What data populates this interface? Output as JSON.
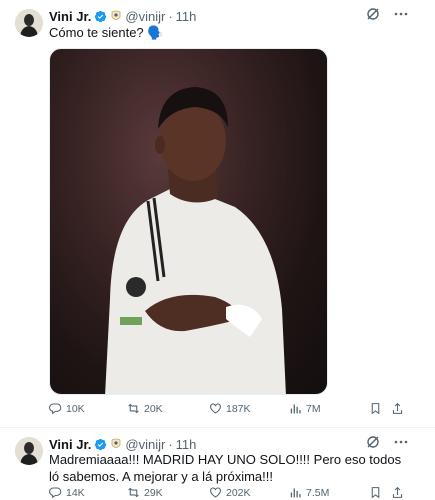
{
  "tweets": [
    {
      "author_name": "Vini Jr.",
      "handle": "@vinijr",
      "separator": "·",
      "time": "11h",
      "text": "Cómo te siente? 🗣️",
      "media": "photo-player-in-white-kit",
      "stats": {
        "replies": "10K",
        "reposts": "20K",
        "likes": "187K",
        "views": "7M"
      }
    },
    {
      "author_name": "Vini Jr.",
      "handle": "@vinijr",
      "separator": "·",
      "time": "11h",
      "text": "Madremiaaaa!!! MADRID HAY UNO SOLO!!!! Pero eso todos ló sabemos. A mejorar y a lá próxima!!!",
      "stats": {
        "replies": "14K",
        "reposts": "29K",
        "likes": "202K",
        "views": "7.5M"
      }
    }
  ],
  "colors": {
    "verified": "#1d9bf0",
    "muted": "#536471",
    "text": "#0f1419"
  },
  "icons": [
    "verified-badge-icon",
    "club-crest-icon",
    "grok-icon",
    "more-icon",
    "reply-icon",
    "repost-icon",
    "like-icon",
    "views-icon",
    "bookmark-icon",
    "share-icon"
  ]
}
